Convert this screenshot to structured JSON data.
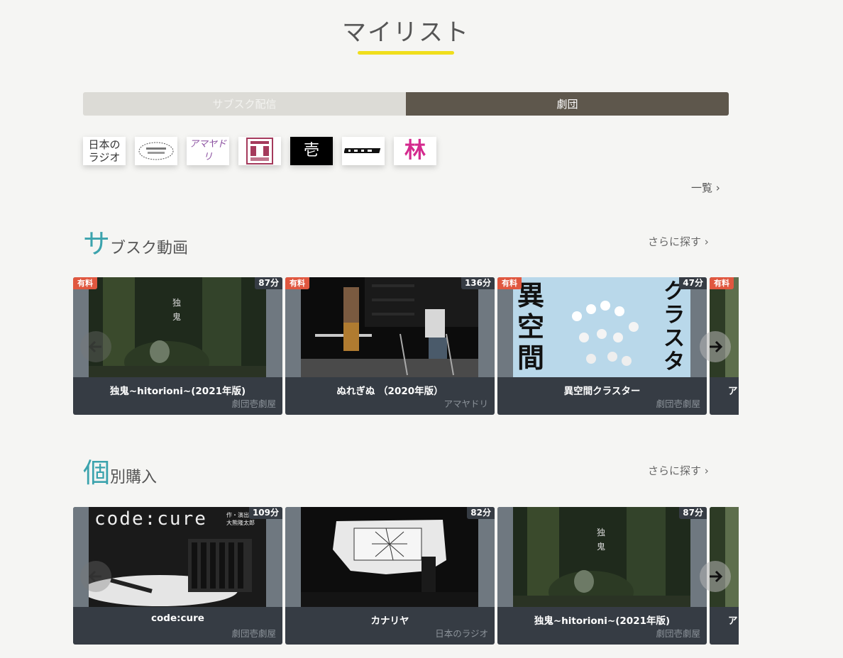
{
  "page": {
    "title": "マイリスト"
  },
  "tabs": [
    {
      "label": "サブスク配信",
      "active": false
    },
    {
      "label": "劇団",
      "active": true
    }
  ],
  "logos": [
    {
      "name": "日本のラジオ",
      "text": "日本の\nラジオ"
    },
    {
      "name": "劇団壱劇屋"
    },
    {
      "name": "アマヤドリ",
      "text": "アマヤドリ"
    },
    {
      "name": "troupe-logo-4"
    },
    {
      "name": "壱",
      "text": "壱"
    },
    {
      "name": "troupe-logo-6"
    },
    {
      "name": "林",
      "text": "林"
    }
  ],
  "view_all": {
    "label": "一覧 ›"
  },
  "sections": [
    {
      "big_char": "サ",
      "rest_title": "ブスク動画",
      "more_label": "さらに探す ›",
      "cards": [
        {
          "paid": "有料",
          "duration": "87分",
          "title": "独鬼~hitorioni~(2021年版)",
          "troupe": "劇団壱劇屋"
        },
        {
          "paid": "有料",
          "duration": "136分",
          "title": "ぬれぎぬ （2020年版）",
          "troupe": "アマヤドリ"
        },
        {
          "paid": "有料",
          "duration": "47分",
          "title": "異空間クラスター",
          "troupe": "劇団壱劇屋"
        },
        {
          "paid": "有料",
          "duration": "",
          "title": "ア",
          "troupe": ""
        }
      ]
    },
    {
      "big_char": "個",
      "rest_title": "別購入",
      "more_label": "さらに探す ›",
      "cards": [
        {
          "paid": "",
          "duration": "109分",
          "title": "code:cure",
          "troupe": "劇団壱劇屋"
        },
        {
          "paid": "",
          "duration": "82分",
          "title": "カナリヤ",
          "troupe": "日本のラジオ"
        },
        {
          "paid": "",
          "duration": "87分",
          "title": "独鬼~hitorioni~(2021年版)",
          "troupe": "劇団壱劇屋"
        },
        {
          "paid": "",
          "duration": "",
          "title": "ア",
          "troupe": ""
        }
      ]
    }
  ],
  "thumb_texts": {
    "hitorioni": "独\n鬼",
    "ikukan_left": "異\n空\n間",
    "ikukan_right": "クラスタ",
    "code_cure": "code:cure",
    "code_cure_credit": "作・演出\n大熊隆太郎"
  },
  "colors": {
    "accent": "#3ba3ad",
    "underline": "#f0de1c",
    "paid_badge": "#e0573f",
    "card_bg": "#363c44",
    "active_tab": "#5e574c"
  },
  "icons": {
    "prev": "arrow-left-icon",
    "next": "arrow-right-icon"
  }
}
